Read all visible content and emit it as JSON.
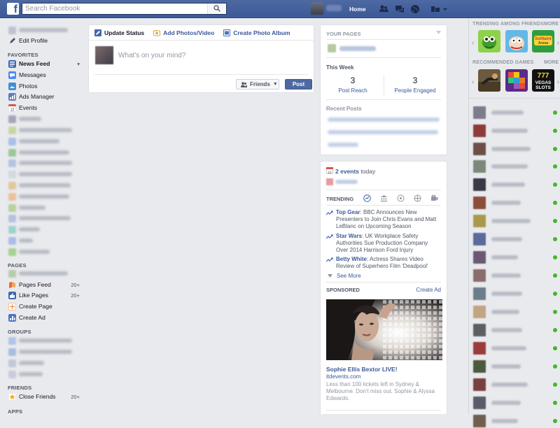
{
  "header": {
    "search_placeholder": "Search Facebook",
    "home_label": "Home"
  },
  "left_nav": {
    "edit_profile": "Edit Profile",
    "favorites_heading": "FAVORITES",
    "favorites": [
      {
        "label": "News Feed",
        "icon": "news-feed-icon",
        "color": "#4267b2"
      },
      {
        "label": "Messages",
        "icon": "messages-icon",
        "color": "#4a8af4"
      },
      {
        "label": "Photos",
        "icon": "photos-icon",
        "color": "#3f8ed8"
      },
      {
        "label": "Ads Manager",
        "icon": "ads-manager-icon",
        "color": "#5b7cbd"
      },
      {
        "label": "Events",
        "icon": "events-icon",
        "color": "#d9534f"
      }
    ],
    "pages_heading": "PAGES",
    "pages": [
      {
        "label": "Pages Feed",
        "count": "20+",
        "icon": "pages-feed-icon",
        "color": "#e4703a"
      },
      {
        "label": "Like Pages",
        "count": "20+",
        "icon": "like-pages-icon",
        "color": "#4267b2"
      },
      {
        "label": "Create Page",
        "count": "",
        "icon": "create-page-icon",
        "color": "#f07e2b"
      },
      {
        "label": "Create Ad",
        "count": "",
        "icon": "create-ad-icon",
        "color": "#4a73c4"
      }
    ],
    "groups_heading": "GROUPS",
    "friends_heading": "FRIENDS",
    "friends": [
      {
        "label": "Close Friends",
        "count": "20+",
        "icon": "star-icon",
        "color": "#f5a623"
      }
    ],
    "apps_heading": "APPS"
  },
  "composer": {
    "tabs": [
      "Update Status",
      "Add Photos/Video",
      "Create Photo Album"
    ],
    "placeholder": "What's on your mind?",
    "audience_label": "Friends",
    "post_label": "Post"
  },
  "pages_panel": {
    "title": "YOUR PAGES",
    "this_week": "This Week",
    "post_reach_value": "3",
    "post_reach_label": "Post Reach",
    "engaged_value": "3",
    "engaged_label": "People Engaged",
    "recent_posts": "Recent Posts"
  },
  "events": {
    "count_label": "2 events",
    "today_label": "today"
  },
  "trending": {
    "title": "TRENDING",
    "items": [
      {
        "topic": "Top Gear",
        "text": ": BBC Announces New Presenters to Join Chris Evans and Matt LeBlanc on Upcoming Season"
      },
      {
        "topic": "Star Wars",
        "text": ": UK Workplace Safety Authorities Sue Production Company Over 2014 Harrison Ford Injury"
      },
      {
        "topic": "Betty White",
        "text": ": Actress Shares Video Review of Superhero Film 'Deadpool'"
      }
    ],
    "see_more": "See More"
  },
  "sponsored": {
    "title": "SPONSORED",
    "create_ad": "Create Ad",
    "ad_title": "Sophie Ellis Bextor LIVE!",
    "ad_url": "itdevents.com",
    "ad_text": "Less than 100 tickets left in Sydney & Melbourne. Don't miss out. Sophie & Alyssa Edwards."
  },
  "right_sidebar": {
    "trending_friends": "TRENDING AMONG FRIENDS",
    "recommended_games": "RECOMMENDED GAMES",
    "more": "MORE"
  }
}
